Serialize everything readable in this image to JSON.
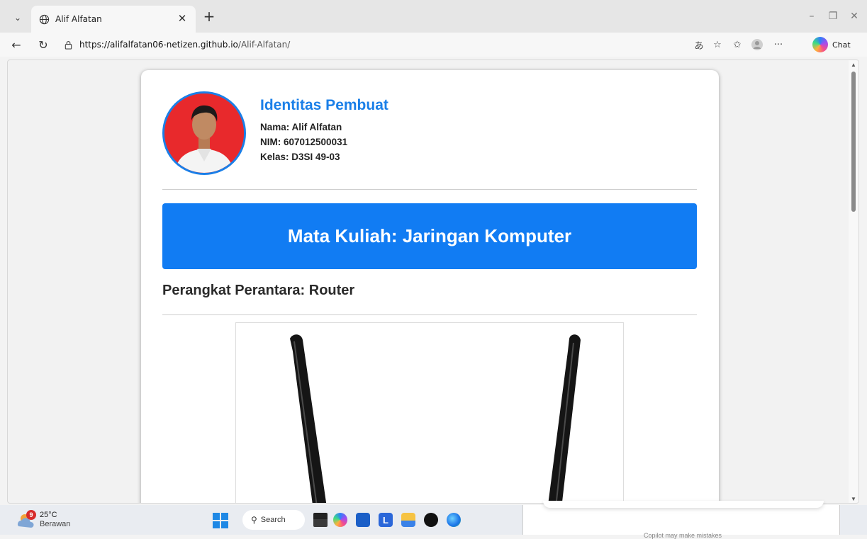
{
  "browser": {
    "tab_title": "Alif Alfatan",
    "url_host": "https://alifalfatan06-netizen.github.io",
    "url_path": "/Alif-Alfatan/",
    "chat_label": "Chat"
  },
  "page": {
    "identity_heading": "Identitas Pembuat",
    "name_line": "Nama: Alif Alfatan",
    "nim_line": "NIM: 607012500031",
    "class_line": "Kelas: D3SI 49-03",
    "banner_title": "Mata Kuliah: Jaringan Komputer",
    "section_title": "Perangkat Perantara: Router"
  },
  "taskbar": {
    "weather_temp": "25°C",
    "weather_desc": "Berawan",
    "weather_badge": "9",
    "search_label": "Search",
    "app_l_label": "L",
    "copilot_message": "Copilot may make mistakes"
  },
  "colors": {
    "accent_blue": "#1a7fe8",
    "banner_blue": "#117cf3",
    "photo_background_red": "#e8292c"
  }
}
